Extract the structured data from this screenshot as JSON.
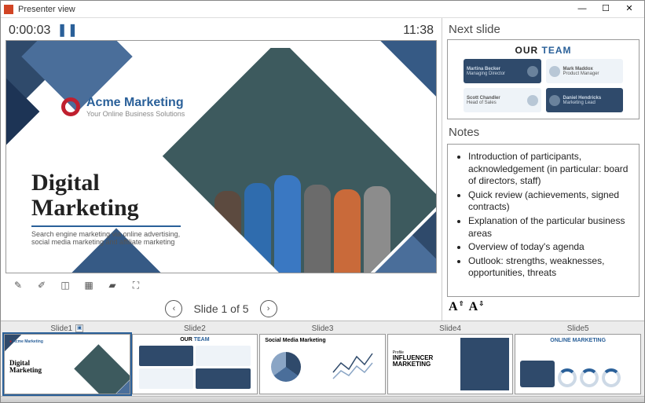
{
  "window": {
    "title": "Presenter view"
  },
  "timer": {
    "elapsed": "0:00:03",
    "clock": "11:38"
  },
  "slide": {
    "company": "Acme Marketing",
    "tagline": "Your Online Business Solutions",
    "title_line1": "Digital",
    "title_line2": "Marketing",
    "subtitle": "Search engine marketing via online advertising, social media marketing and affiliate marketing"
  },
  "nav": {
    "counter": "Slide 1 of 5"
  },
  "next": {
    "label": "Next slide",
    "title_our": "OUR",
    "title_team": " TEAM",
    "members": [
      {
        "name": "Martina Becker",
        "role": "Managing Director"
      },
      {
        "name": "Mark Maddox",
        "role": "Product Manager"
      },
      {
        "name": "Scott Chandler",
        "role": "Head of Sales"
      },
      {
        "name": "Daniel Hendricks",
        "role": "Marketing Lead"
      }
    ]
  },
  "notes": {
    "label": "Notes",
    "items": [
      "Introduction of participants, acknowledgement (in particular: board of directors, staff)",
      "Quick review (achievements, signed contracts)",
      "Explanation of the particular business areas",
      "Overview of today's agenda",
      "Outlook: strengths, weaknesses, opportunities, threats"
    ]
  },
  "thumbs": [
    {
      "label": "Slide1",
      "hidden_toggle": true
    },
    {
      "label": "Slide2"
    },
    {
      "label": "Slide3"
    },
    {
      "label": "Slide4"
    },
    {
      "label": "Slide5"
    }
  ],
  "thumb_content": {
    "1": {
      "logo": "Acme Marketing",
      "t1": "Digital",
      "t2": "Marketing"
    },
    "2": {
      "our": "OUR",
      "team": " TEAM"
    },
    "3": {
      "title": "Social Media Marketing"
    },
    "4": {
      "pre": "Profile",
      "t1": "INFLUENCER",
      "t2": "MARKETING"
    },
    "5": {
      "title": "ONLINE MARKETING"
    }
  },
  "icons": {
    "pen": "✎",
    "highlighter": "✐",
    "eraser": "◫",
    "grid": "▦",
    "blank": "▰",
    "options": "⛶",
    "prev": "‹",
    "next": "›",
    "font_inc": "A",
    "font_dec": "A",
    "min": "—",
    "max": "☐",
    "close": "✕",
    "pause": "❚❚"
  }
}
